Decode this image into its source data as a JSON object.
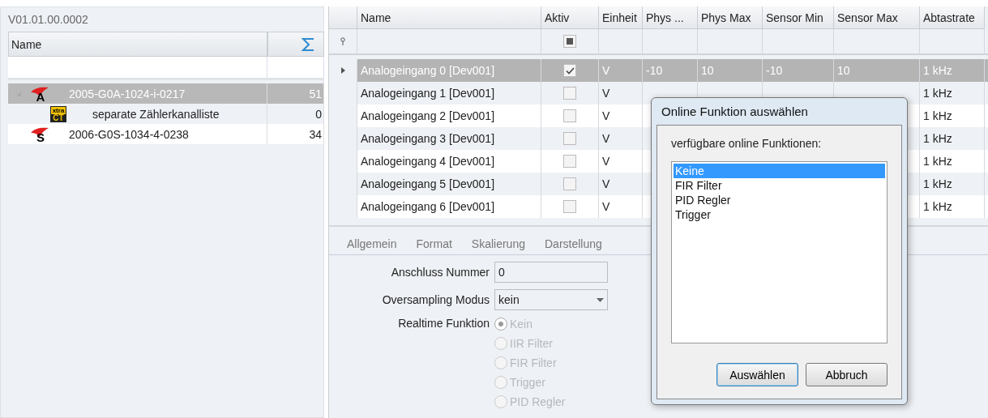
{
  "version": "V01.01.00.0002",
  "tree": {
    "columns": [
      "Name"
    ],
    "items": [
      {
        "kind": "device",
        "badge": "A",
        "name": "2005-G0A-1024-i-0217",
        "count": "51",
        "selected": true,
        "expanded": true,
        "children": [
          {
            "kind": "counter-list",
            "badge_lines": [
              "xtra",
              "CT"
            ],
            "name": "separate Zählerkanalliste",
            "count": "0",
            "selected": false
          }
        ]
      },
      {
        "kind": "device",
        "badge": "S",
        "name": "2006-G0S-1034-4-0238",
        "count": "34",
        "selected": false
      }
    ]
  },
  "grid": {
    "columns": [
      "Name",
      "Aktiv",
      "Einheit",
      "Phys ...",
      "Phys Max",
      "Sensor Min",
      "Sensor Max",
      "Abtastrate"
    ],
    "filter_aktiv_indeterminate": true,
    "rows": [
      {
        "name": "Analogeingang 0 [Dev001]",
        "aktiv": true,
        "unit": "V",
        "phys_min": "-10",
        "phys_max": "10",
        "sensor_min": "-10",
        "sensor_max": "10",
        "rate": "1 kHz",
        "selected": true
      },
      {
        "name": "Analogeingang 1 [Dev001]",
        "aktiv": false,
        "unit": "V",
        "rate": "1 kHz",
        "selected": false
      },
      {
        "name": "Analogeingang 2 [Dev001]",
        "aktiv": false,
        "unit": "V",
        "rate": "1 kHz",
        "selected": false
      },
      {
        "name": "Analogeingang 3 [Dev001]",
        "aktiv": false,
        "unit": "V",
        "rate": "1 kHz",
        "selected": false
      },
      {
        "name": "Analogeingang 4 [Dev001]",
        "aktiv": false,
        "unit": "V",
        "rate": "1 kHz",
        "selected": false
      },
      {
        "name": "Analogeingang 5 [Dev001]",
        "aktiv": false,
        "unit": "V",
        "rate": "1 kHz",
        "selected": false
      },
      {
        "name": "Analogeingang 6 [Dev001]",
        "aktiv": false,
        "unit": "V",
        "rate": "1 kHz",
        "selected": false
      }
    ]
  },
  "tabs": [
    {
      "label": "Allgemein",
      "selected": false
    },
    {
      "label": "Format",
      "selected": false
    },
    {
      "label": "Skalierung",
      "selected": false
    },
    {
      "label": "Darstellung",
      "selected": false
    }
  ],
  "form": {
    "anschluss": {
      "label": "Anschluss Nummer",
      "value": "0"
    },
    "oversampling": {
      "label": "Oversampling Modus",
      "value": "kein"
    },
    "realtime": {
      "label": "Realtime Funktion",
      "disabled": true,
      "options": [
        {
          "label": "Kein",
          "selected": true
        },
        {
          "label": "IIR Filter",
          "selected": false
        },
        {
          "label": "FIR Filter",
          "selected": false
        },
        {
          "label": "Trigger",
          "selected": false
        },
        {
          "label": "PID Regler",
          "selected": false
        }
      ]
    }
  },
  "dialog": {
    "title": "Online Funktion auswählen",
    "prompt": "verfügbare online Funktionen:",
    "items": [
      {
        "label": "Keine",
        "selected": true
      },
      {
        "label": "FIR Filter",
        "selected": false
      },
      {
        "label": "PID Regler",
        "selected": false
      },
      {
        "label": "Trigger",
        "selected": false
      }
    ],
    "buttons": [
      {
        "label": "Auswählen",
        "default": true
      },
      {
        "label": "Abbruch",
        "default": false
      }
    ]
  }
}
